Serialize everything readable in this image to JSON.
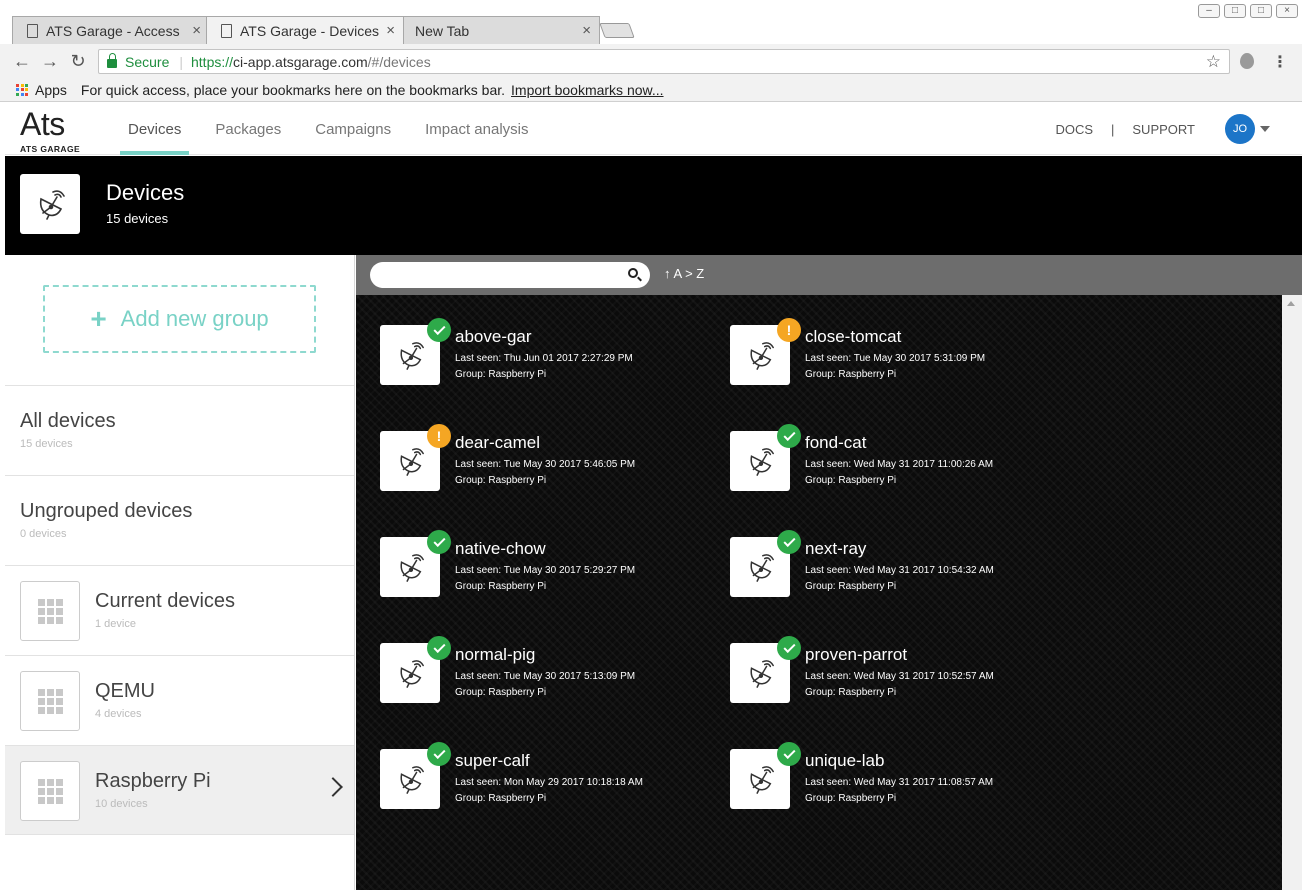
{
  "browser": {
    "tabs": [
      {
        "title": "ATS Garage - Access",
        "close": "×",
        "active": false
      },
      {
        "title": "ATS Garage - Devices",
        "close": "×",
        "active": true
      },
      {
        "title": "New Tab",
        "close": "×",
        "active": false
      }
    ],
    "address": {
      "secure_label": "Secure",
      "url_scheme": "https://",
      "url_host": "ci-app.atsgarage.com",
      "url_path": "/#/devices"
    },
    "bookmarks": {
      "apps_label": "Apps",
      "hint": "For quick access, place your bookmarks here on the bookmarks bar.",
      "import_link": "Import bookmarks now..."
    }
  },
  "header": {
    "logo_text": "Ats",
    "logo_subtext": "ATS GARAGE",
    "nav": [
      "Devices",
      "Packages",
      "Campaigns",
      "Impact analysis"
    ],
    "active_nav": "Devices",
    "docs": "DOCS",
    "divider": "|",
    "support": "SUPPORT",
    "avatar_initials": "JO",
    "accent_color": "#79d2c6"
  },
  "title_bar": {
    "title": "Devices",
    "count": "15 devices"
  },
  "sidebar": {
    "add_group_label": "Add new group",
    "groups": [
      {
        "name": "All devices",
        "count": "15 devices"
      },
      {
        "name": "Ungrouped devices",
        "count": "0 devices"
      },
      {
        "name": "Current devices",
        "count": "1 device"
      },
      {
        "name": "QEMU",
        "count": "4 devices"
      },
      {
        "name": "Raspberry Pi",
        "count": "10 devices"
      }
    ]
  },
  "device_panel": {
    "search_placeholder": "",
    "sort_arrow": "↑",
    "sort_label": "A > Z",
    "devices": [
      {
        "name": "above-gar",
        "last_seen": "Last seen: Thu Jun 01 2017 2:27:29 PM",
        "group": "Group: Raspberry Pi",
        "status": "ok"
      },
      {
        "name": "close-tomcat",
        "last_seen": "Last seen: Tue May 30 2017 5:31:09 PM",
        "group": "Group: Raspberry Pi",
        "status": "warning"
      },
      {
        "name": "dear-camel",
        "last_seen": "Last seen: Tue May 30 2017 5:46:05 PM",
        "group": "Group: Raspberry Pi",
        "status": "warning"
      },
      {
        "name": "fond-cat",
        "last_seen": "Last seen: Wed May 31 2017 11:00:26 AM",
        "group": "Group: Raspberry Pi",
        "status": "ok"
      },
      {
        "name": "native-chow",
        "last_seen": "Last seen: Tue May 30 2017 5:29:27 PM",
        "group": "Group: Raspberry Pi",
        "status": "ok"
      },
      {
        "name": "next-ray",
        "last_seen": "Last seen: Wed May 31 2017 10:54:32 AM",
        "group": "Group: Raspberry Pi",
        "status": "ok"
      },
      {
        "name": "normal-pig",
        "last_seen": "Last seen: Tue May 30 2017 5:13:09 PM",
        "group": "Group: Raspberry Pi",
        "status": "ok"
      },
      {
        "name": "proven-parrot",
        "last_seen": "Last seen: Wed May 31 2017 10:52:57 AM",
        "group": "Group: Raspberry Pi",
        "status": "ok"
      },
      {
        "name": "super-calf",
        "last_seen": "Last seen: Mon May 29 2017 10:18:18 AM",
        "group": "Group: Raspberry Pi",
        "status": "ok"
      },
      {
        "name": "unique-lab",
        "last_seen": "Last seen: Wed May 31 2017 11:08:57 AM",
        "group": "Group: Raspberry Pi",
        "status": "ok"
      }
    ]
  },
  "colors": {
    "status_ok": "#2eaa4a",
    "status_warning": "#f5a623",
    "avatar": "#1c75c8"
  }
}
